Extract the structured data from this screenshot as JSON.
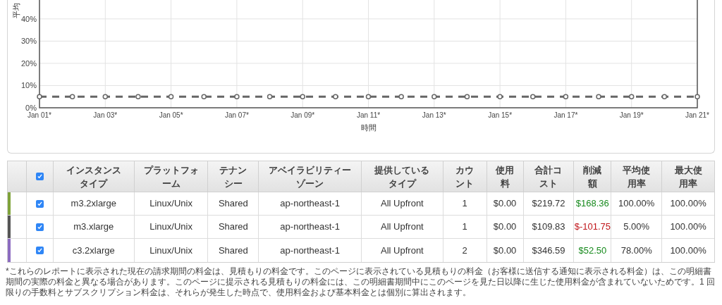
{
  "chart": {
    "chart_data": {
      "type": "line",
      "xlabel": "時間",
      "ylabel": "平均",
      "grid": true,
      "categories": [
        "Jan 01*",
        null,
        "Jan 03*",
        null,
        "Jan 05*",
        null,
        "Jan 07*",
        null,
        "Jan 09*",
        null,
        "Jan 11*",
        null,
        "Jan 13*",
        null,
        "Jan 15*",
        null,
        "Jan 17*",
        null,
        "Jan 19*",
        null,
        "Jan 21*"
      ],
      "series": [
        {
          "color": "#666666",
          "line_style": "dashed",
          "marker": "circle",
          "values": [
            5,
            5,
            5,
            5,
            5,
            5,
            5,
            5,
            5,
            5,
            5,
            5,
            5,
            5,
            5,
            5,
            5,
            5,
            5,
            5,
            5
          ]
        }
      ],
      "ylim": [
        0,
        48.5
      ],
      "yticks": [
        {
          "value": 0,
          "label": "0%"
        },
        {
          "value": 10,
          "label": "10%"
        },
        {
          "value": 20,
          "label": "20%"
        },
        {
          "value": 30,
          "label": "30%"
        },
        {
          "value": 40,
          "label": "40%"
        }
      ]
    }
  },
  "table": {
    "header_checked": true,
    "columns": [
      "インスタンスタイプ",
      "プラットフォーム",
      "テナンシー",
      "アベイラビリティーゾーン",
      "提供しているタイプ",
      "カウント",
      "使用料",
      "合計コスト",
      "削減額",
      "平均使用率",
      "最大使用率"
    ],
    "rows": [
      {
        "color": "#7fa33a",
        "checked": true,
        "cells": [
          "m3.2xlarge",
          "Linux/Unix",
          "Shared",
          "ap-northeast-1",
          "All Upfront",
          "1",
          "$0.00",
          "$219.72"
        ],
        "savings": {
          "text": "$168.36",
          "color": "#178a1d"
        },
        "usage": [
          "100.00%",
          "100.00%"
        ]
      },
      {
        "color": "#555555",
        "checked": true,
        "cells": [
          "m3.xlarge",
          "Linux/Unix",
          "Shared",
          "ap-northeast-1",
          "All Upfront",
          "1",
          "$0.00",
          "$109.83"
        ],
        "savings": {
          "text": "$-101.75",
          "color": "#c0161b"
        },
        "usage": [
          "5.00%",
          "100.00%"
        ]
      },
      {
        "color": "#8c6bc0",
        "checked": true,
        "cells": [
          "c3.2xlarge",
          "Linux/Unix",
          "Shared",
          "ap-northeast-1",
          "All Upfront",
          "2",
          "$0.00",
          "$346.59"
        ],
        "savings": {
          "text": "$52.50",
          "color": "#178a1d"
        },
        "usage": [
          "78.00%",
          "100.00%"
        ]
      }
    ]
  },
  "footnote": "*これらのレポートに表示された現在の請求期間の料金は、見積もりの料金です。このページに表示されている見積もりの料金（お客様に送信する通知に表示される料金）は、この明細書期間の実際の料金と異なる場合があります。このページに提示される見積もりの料金には、この明細書期間中にこのページを見た日以降に生じた使用料金が含まれていないためです。1 回限りの手数料とサブスクリプション料金は、それらが発生した時点で、使用料金および基本料金とは個別に算出されます。"
}
